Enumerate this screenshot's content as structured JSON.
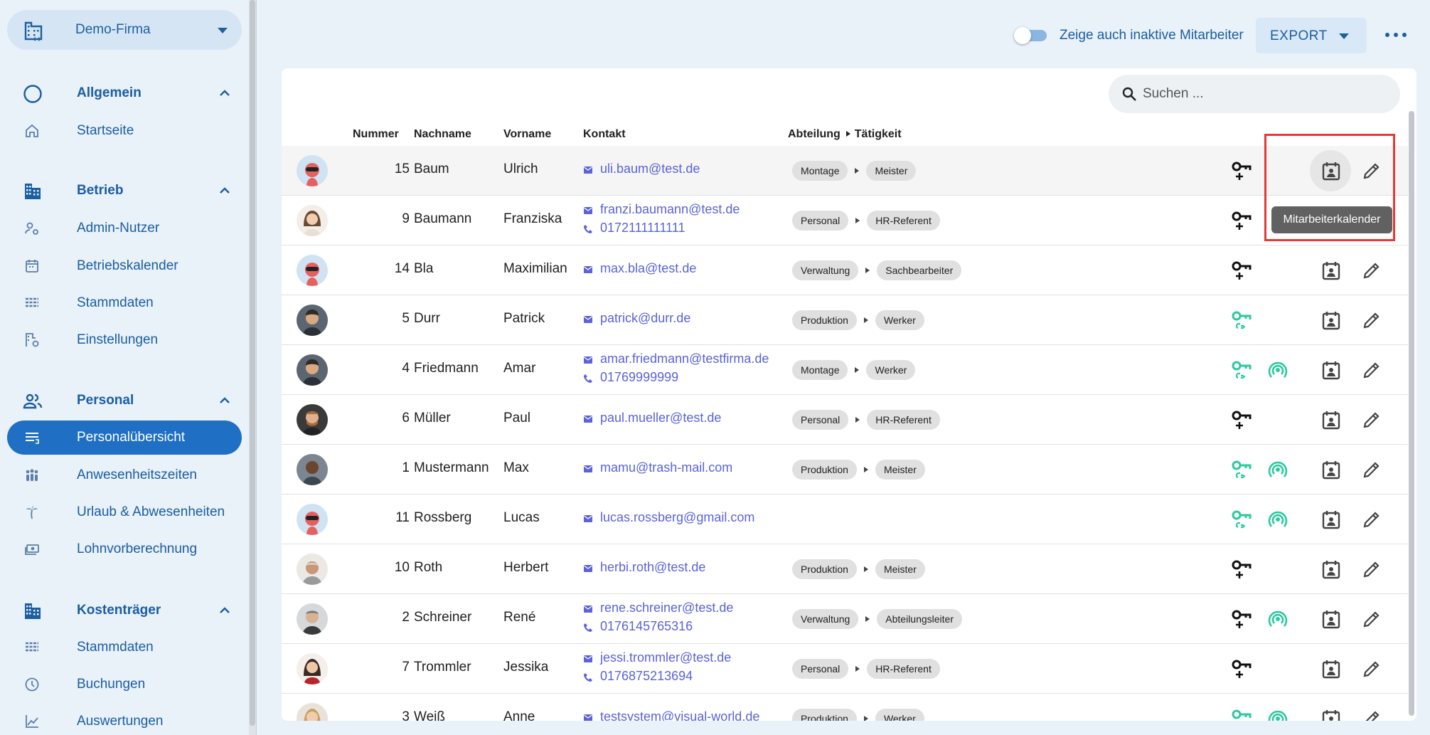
{
  "company": {
    "name": "Demo-Firma"
  },
  "sidebar": {
    "sections": [
      {
        "label": "Allgemein",
        "items": [
          {
            "label": "Startseite"
          }
        ]
      },
      {
        "label": "Betrieb",
        "items": [
          {
            "label": "Admin-Nutzer"
          },
          {
            "label": "Betriebskalender"
          },
          {
            "label": "Stammdaten"
          },
          {
            "label": "Einstellungen"
          }
        ]
      },
      {
        "label": "Personal",
        "items": [
          {
            "label": "Personalübersicht"
          },
          {
            "label": "Anwesenheitszeiten"
          },
          {
            "label": "Urlaub & Abwesenheiten"
          },
          {
            "label": "Lohnvorberechnung"
          }
        ]
      },
      {
        "label": "Kostenträger",
        "items": [
          {
            "label": "Stammdaten"
          },
          {
            "label": "Buchungen"
          },
          {
            "label": "Auswertungen"
          }
        ]
      }
    ]
  },
  "toolbar": {
    "toggle_label": "Zeige auch inaktive Mitarbeiter",
    "toggle_on": false,
    "export_label": "EXPORT"
  },
  "search": {
    "placeholder": "Suchen ..."
  },
  "table": {
    "headers": {
      "number": "Nummer",
      "lastname": "Nachname",
      "firstname": "Vorname",
      "contact": "Kontakt",
      "department": "Abteilung",
      "activity": "Tätigkeit"
    },
    "rows": [
      {
        "number": "15",
        "lastname": "Baum",
        "firstname": "Ulrich",
        "email": "uli.baum@test.de",
        "phone": "",
        "department": "Montage",
        "activity": "Meister",
        "avatar": "robot",
        "key_linked": false,
        "nfc": false,
        "hover": true
      },
      {
        "number": "9",
        "lastname": "Baumann",
        "firstname": "Franziska",
        "email": "franzi.baumann@test.de",
        "phone": "0172111111111",
        "department": "Personal",
        "activity": "HR-Referent",
        "avatar": "woman",
        "key_linked": false,
        "nfc": false
      },
      {
        "number": "14",
        "lastname": "Bla",
        "firstname": "Maximilian",
        "email": "max.bla@test.de",
        "phone": "",
        "department": "Verwaltung",
        "activity": "Sachbearbeiter",
        "avatar": "robot",
        "key_linked": false,
        "nfc": false
      },
      {
        "number": "5",
        "lastname": "Durr",
        "firstname": "Patrick",
        "email": "patrick@durr.de",
        "phone": "",
        "department": "Produktion",
        "activity": "Werker",
        "avatar": "man",
        "key_linked": true,
        "nfc": false
      },
      {
        "number": "4",
        "lastname": "Friedmann",
        "firstname": "Amar",
        "email": "amar.friedmann@testfirma.de",
        "phone": "01769999999",
        "department": "Montage",
        "activity": "Werker",
        "avatar": "man",
        "key_linked": true,
        "nfc": true
      },
      {
        "number": "6",
        "lastname": "Müller",
        "firstname": "Paul",
        "email": "paul.mueller@test.de",
        "phone": "",
        "department": "Personal",
        "activity": "HR-Referent",
        "avatar": "man-beard",
        "key_linked": false,
        "nfc": false
      },
      {
        "number": "1",
        "lastname": "Mustermann",
        "firstname": "Max",
        "email": "mamu@trash-mail.com",
        "phone": "",
        "department": "Produktion",
        "activity": "Meister",
        "avatar": "man-dark",
        "key_linked": true,
        "nfc": true
      },
      {
        "number": "11",
        "lastname": "Rossberg",
        "firstname": "Lucas",
        "email": "lucas.rossberg@gmail.com",
        "phone": "",
        "department": "",
        "activity": "",
        "avatar": "robot",
        "key_linked": true,
        "nfc": true
      },
      {
        "number": "10",
        "lastname": "Roth",
        "firstname": "Herbert",
        "email": "herbi.roth@test.de",
        "phone": "",
        "department": "Produktion",
        "activity": "Meister",
        "avatar": "man-old",
        "key_linked": false,
        "nfc": false
      },
      {
        "number": "2",
        "lastname": "Schreiner",
        "firstname": "René",
        "email": "rene.schreiner@test.de",
        "phone": "0176145765316",
        "department": "Verwaltung",
        "activity": "Abteilungsleiter",
        "avatar": "man-gray",
        "key_linked": false,
        "nfc": true
      },
      {
        "number": "7",
        "lastname": "Trommler",
        "firstname": "Jessika",
        "email": "jessi.trommler@test.de",
        "phone": "0176875213694",
        "department": "Personal",
        "activity": "HR-Referent",
        "avatar": "woman-red",
        "key_linked": false,
        "nfc": false
      },
      {
        "number": "3",
        "lastname": "Weiß",
        "firstname": "Anne",
        "email": "testsystem@visual-world.de",
        "phone": "",
        "department": "Produktion",
        "activity": "Werker",
        "avatar": "woman-blond",
        "key_linked": true,
        "nfc": true
      }
    ]
  },
  "tooltip": {
    "text": "Mitarbeiterkalender"
  },
  "colors": {
    "accent": "#1f70c4",
    "link": "#5a63d8",
    "linked_green": "#2bc9a0",
    "highlight": "#e53935"
  }
}
